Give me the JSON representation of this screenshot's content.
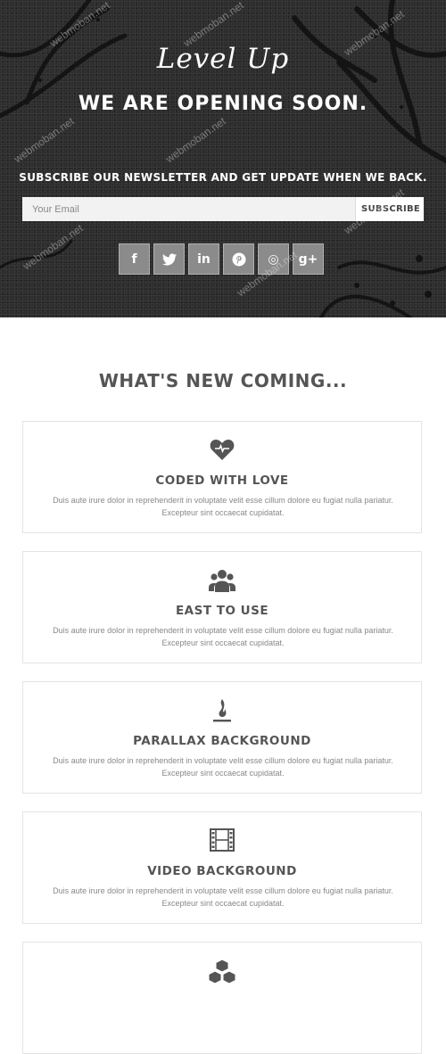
{
  "hero": {
    "logo": "Level Up",
    "headline": "WE ARE OPENING SOON.",
    "subscribe_heading": "SUBSCRIBE OUR NEWSLETTER AND GET UPDATE WHEN WE BACK.",
    "email_placeholder": "Your Email",
    "subscribe_button": "SUBSCRIBE",
    "social": [
      {
        "icon": "facebook-icon",
        "glyph": "f"
      },
      {
        "icon": "twitter-icon",
        "glyph": "t"
      },
      {
        "icon": "linkedin-icon",
        "glyph": "in"
      },
      {
        "icon": "pinterest-icon",
        "glyph": "p"
      },
      {
        "icon": "dribbble-icon",
        "glyph": "◎"
      },
      {
        "icon": "google-plus-icon",
        "glyph": "g+"
      }
    ],
    "watermark": "webmoban.net"
  },
  "features": {
    "title": "WHAT'S NEW COMING...",
    "description": "Duis aute irure dolor in reprehenderit in voluptate velit esse cillum dolore eu fugiat nulla pariatur. Excepteur sint occaecat cupidatat.",
    "items": [
      {
        "icon": "heart-icon",
        "title": "CODED WITH LOVE"
      },
      {
        "icon": "users-icon",
        "title": "EAST TO USE"
      },
      {
        "icon": "fire-icon",
        "title": "PARALLAX BACKGROUND"
      },
      {
        "icon": "film-icon",
        "title": "VIDEO BACKGROUND"
      },
      {
        "icon": "cubes-icon",
        "title": ""
      }
    ]
  },
  "colors": {
    "hero_bg": "#2d2d2d",
    "social_bg": "#8b8b8b",
    "text": "#555555"
  }
}
